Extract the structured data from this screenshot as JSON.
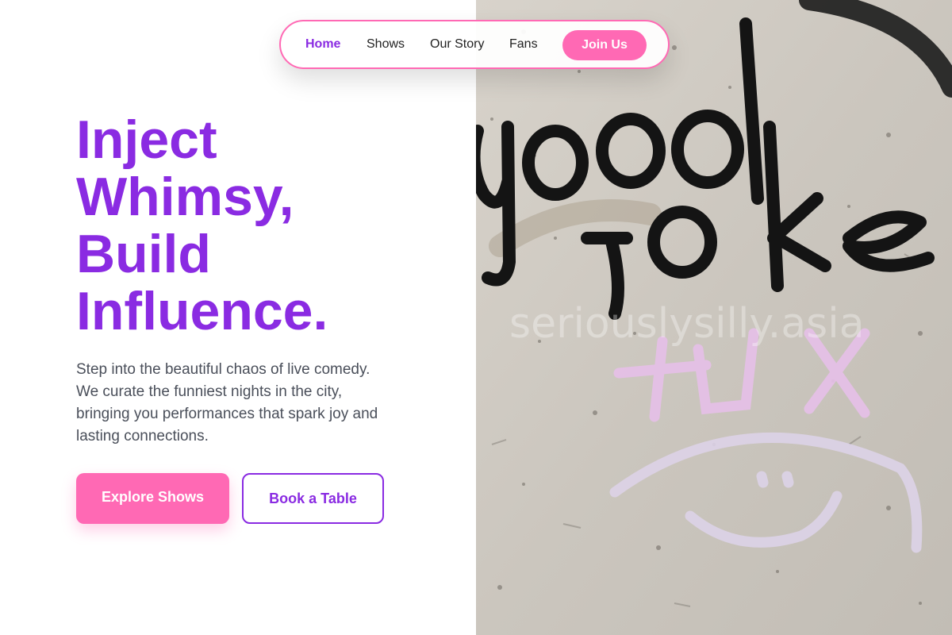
{
  "nav": {
    "links": [
      {
        "label": "Home",
        "active": true
      },
      {
        "label": "Shows",
        "active": false
      },
      {
        "label": "Our Story",
        "active": false
      },
      {
        "label": "Fans",
        "active": false
      }
    ],
    "cta_label": "Join Us"
  },
  "hero": {
    "title_lines": [
      "Inject",
      "Whimsy,",
      "Build",
      "Influence."
    ],
    "description_lines": [
      "Step into the beautiful chaos of live comedy.",
      "We curate the funniest nights in the city,",
      "bringing you performances that spark joy and",
      "lasting connections."
    ],
    "primary_button": "Explore Shows",
    "secondary_button": "Book a Table"
  },
  "image": {
    "watermark": "seriouslysilly.asia",
    "alt": "Graffiti on a wall reading \"good joke\" with a chalk smiley face",
    "graffiti_text": "good joke"
  },
  "colors": {
    "accent_purple": "#8a2be2",
    "accent_pink": "#ff69b4",
    "text_gray": "#4a4f5a"
  }
}
